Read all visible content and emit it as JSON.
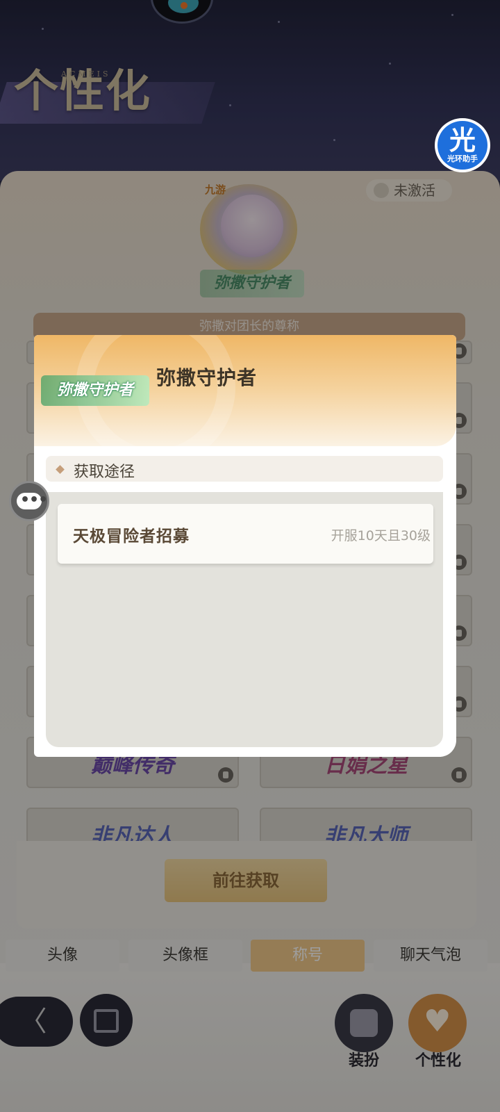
{
  "background": {
    "section_title": "个性化",
    "section_subtitle": "ACMEIS"
  },
  "assistant": {
    "glyph": "光",
    "label": "光环助手"
  },
  "profile": {
    "brand_logo": "九游",
    "equipped_title": "弥撒守护者",
    "status": "未激活",
    "caption": "弥撒对团长的尊称"
  },
  "grid": {
    "tiles": [
      {
        "text": "巅峰传奇",
        "color": "#6b4aa8"
      },
      {
        "text": "日娟之星",
        "color": "#a84a7a"
      },
      {
        "text": "非凡达人",
        "color": "#5a66b8"
      },
      {
        "text": "非凡大师",
        "color": "#5a66b8"
      }
    ]
  },
  "action_button": "前往获取",
  "tabs": [
    {
      "label": "头像",
      "active": false
    },
    {
      "label": "头像框",
      "active": false
    },
    {
      "label": "称号",
      "active": true
    },
    {
      "label": "聊天气泡",
      "active": false
    }
  ],
  "bottom_nav": {
    "back_glyph": "〈",
    "dress_label": "装扮",
    "personal_label": "个性化"
  },
  "modal": {
    "badge": "弥撒守护者",
    "title": "弥撒守护者",
    "section_label": "获取途径",
    "sources": [
      {
        "name": "天极冒险者招募",
        "requirement": "开服10天且30级"
      }
    ]
  },
  "colors": {
    "accent": "#f0c98a",
    "header_orange": "#efb766",
    "badge_green": "#46a064"
  }
}
